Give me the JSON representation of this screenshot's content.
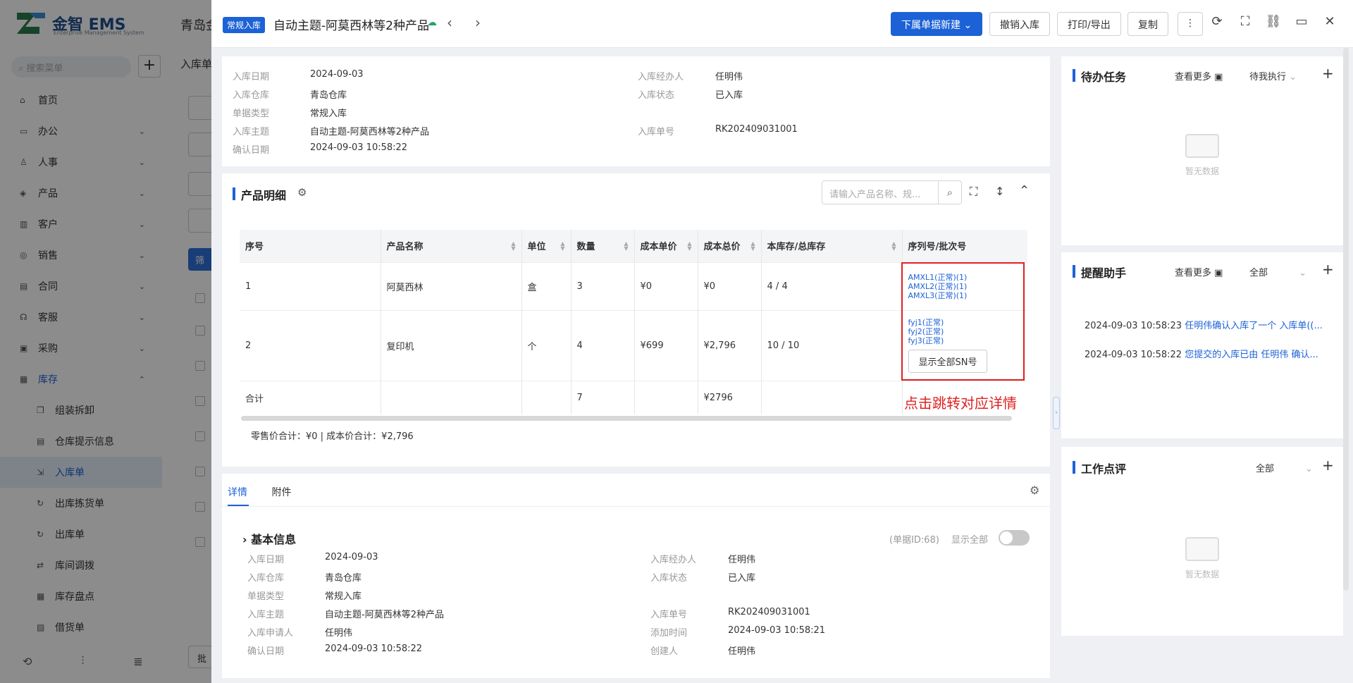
{
  "background": {
    "logo_name": "金智 EMS",
    "logo_sub": "Enterprise Management System",
    "search_placeholder": "搜索菜单",
    "top_title": "青岛金",
    "tab_title": "入库单",
    "filter_button": "筛",
    "batch_label": "批",
    "nav": [
      {
        "label": "首页",
        "icon": "home-icon"
      },
      {
        "label": "办公",
        "icon": "office-icon"
      },
      {
        "label": "人事",
        "icon": "person-icon"
      },
      {
        "label": "产品",
        "icon": "product-icon"
      },
      {
        "label": "客户",
        "icon": "customer-icon"
      },
      {
        "label": "销售",
        "icon": "sales-icon"
      },
      {
        "label": "合同",
        "icon": "contract-icon"
      },
      {
        "label": "客服",
        "icon": "service-icon"
      },
      {
        "label": "采购",
        "icon": "purchase-icon"
      },
      {
        "label": "库存",
        "icon": "inventory-icon"
      }
    ],
    "subnav": [
      {
        "label": "组装拆卸"
      },
      {
        "label": "仓库提示信息"
      },
      {
        "label": "入库单"
      },
      {
        "label": "出库拣货单"
      },
      {
        "label": "出库单"
      },
      {
        "label": "库间调拨"
      },
      {
        "label": "库存盘点"
      },
      {
        "label": "借货单"
      }
    ]
  },
  "header": {
    "badge": "常规入库",
    "title": "自动主题-阿莫西林等2种产品",
    "btn_new": "下属单据新建",
    "btn_revoke": "撤销入库",
    "btn_print": "打印/导出",
    "btn_copy": "复制"
  },
  "summary": {
    "date_label": "入库日期",
    "date": "2024-09-03",
    "warehouse_label": "入库仓库",
    "warehouse": "青岛仓库",
    "type_label": "单据类型",
    "type": "常规入库",
    "subject_label": "入库主题",
    "subject": "自动主题-阿莫西林等2种产品",
    "confirm_label": "确认日期",
    "confirm": "2024-09-03 10:58:22",
    "handler_label": "入库经办人",
    "handler": "任明伟",
    "status_label": "入库状态",
    "status": "已入库",
    "no_label": "入库单号",
    "no": "RK202409031001"
  },
  "products": {
    "title": "产品明细",
    "search_placeholder": "请输入产品名称、规...",
    "columns": [
      "序号",
      "产品名称",
      "单位",
      "数量",
      "成本单价",
      "成本总价",
      "本库存/总库存",
      "序列号/批次号"
    ],
    "rows": [
      {
        "no": "1",
        "name": "阿莫西林",
        "unit": "盒",
        "qty": "3",
        "price": "¥0",
        "total": "¥0",
        "stock": "4",
        "stock_total": "4",
        "sn": [
          "AMXL1(正常)(1)",
          "AMXL2(正常)(1)",
          "AMXL3(正常)(1)"
        ]
      },
      {
        "no": "2",
        "name": "复印机",
        "unit": "个",
        "qty": "4",
        "price": "¥699",
        "total": "¥2,796",
        "stock": "10",
        "stock_total": "10",
        "sn": [
          "fyj1(正常)",
          "fyj2(正常)",
          "fyj3(正常)"
        ],
        "sn_button": "显示全部SN号"
      }
    ],
    "sum_label": "合计",
    "sum_qty": "7",
    "sum_total": "¥2796",
    "annotation": "点击跳转对应详情",
    "totals_line": "零售价合计：¥0 |   成本价合计：¥2,796"
  },
  "detail": {
    "tab_detail": "详情",
    "tab_attach": "附件",
    "section": "基本信息",
    "doc_id": "(单据ID:68)",
    "show_all": "显示全部",
    "date_label": "入库日期",
    "date": "2024-09-03",
    "warehouse_label": "入库仓库",
    "warehouse": "青岛仓库",
    "type_label": "单据类型",
    "type": "常规入库",
    "subject_label": "入库主题",
    "subject": "自动主题-阿莫西林等2种产品",
    "applicant_label": "入库申请人",
    "applicant": "任明伟",
    "confirm_label": "确认日期",
    "confirm": "2024-09-03 10:58:22",
    "handler_label": "入库经办人",
    "handler": "任明伟",
    "status_label": "入库状态",
    "status": "已入库",
    "no_label": "入库单号",
    "no": "RK202409031001",
    "added_label": "添加时间",
    "added": "2024-09-03 10:58:21",
    "creator_label": "创建人",
    "creator": "任明伟"
  },
  "right": {
    "todo_title": "待办任务",
    "more": "查看更多",
    "todo_filter": "待我执行",
    "empty": "暂无数据",
    "remind_title": "提醒助手",
    "remind_filter": "全部",
    "reminders": [
      {
        "time": "2024-09-03 10:58:23",
        "text": "任明伟确认入库了一个 入库单((..."
      },
      {
        "time": "2024-09-03 10:58:22",
        "text": "您提交的入库已由 任明伟 确认..."
      }
    ],
    "review_title": "工作点评",
    "review_filter": "全部"
  }
}
